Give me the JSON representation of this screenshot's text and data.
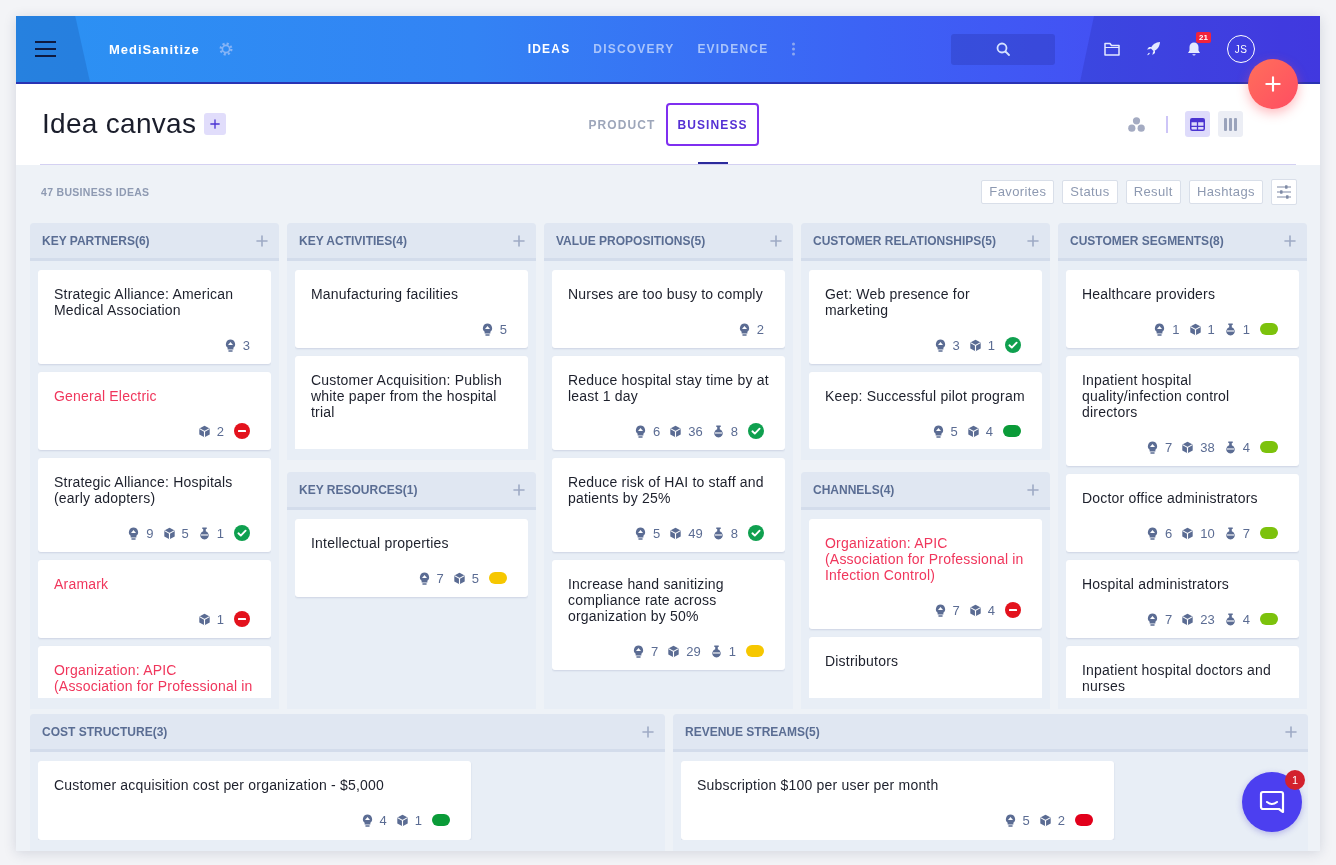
{
  "header": {
    "app_name": "MediSanitize",
    "nav": [
      {
        "label": "IDEAS",
        "selected": true
      },
      {
        "label": "DISCOVERY",
        "selected": false
      },
      {
        "label": "EVIDENCE",
        "selected": false
      }
    ],
    "notifications": "21",
    "avatar": "JS"
  },
  "page": {
    "title": "Idea canvas"
  },
  "tabs": [
    {
      "label": "PRODUCT",
      "selected": false
    },
    {
      "label": "BUSINESS",
      "selected": true
    }
  ],
  "view_modes": [
    {
      "kind": "grid",
      "selected": true
    },
    {
      "kind": "columns",
      "selected": false
    }
  ],
  "summary": "47 BUSINESS IDEAS",
  "filters": [
    "Favorites",
    "Status",
    "Result",
    "Hashtags"
  ],
  "canvas": {
    "columns": [
      {
        "sections": [
          {
            "title": "KEY PARTNERS(6)",
            "cards": [
              {
                "title": "Strategic Alliance: American Medical Association",
                "rejected": false,
                "metrics": [
                  {
                    "kind": "bulb",
                    "value": "3"
                  }
                ]
              },
              {
                "title": "General Electric",
                "rejected": true,
                "metrics": [
                  {
                    "kind": "cube",
                    "value": "2"
                  }
                ],
                "status": {
                  "kind": "minus"
                }
              },
              {
                "title": "Strategic Alliance: Hospitals (early adopters)",
                "rejected": false,
                "metrics": [
                  {
                    "kind": "bulb",
                    "value": "9"
                  },
                  {
                    "kind": "cube",
                    "value": "5"
                  },
                  {
                    "kind": "flask",
                    "value": "1"
                  }
                ],
                "status": {
                  "kind": "check"
                }
              },
              {
                "title": "Aramark",
                "rejected": true,
                "metrics": [
                  {
                    "kind": "cube",
                    "value": "1"
                  }
                ],
                "status": {
                  "kind": "minus"
                }
              },
              {
                "title": "Organization: APIC (Association for Professional in",
                "rejected": true
              }
            ]
          }
        ]
      },
      {
        "sections": [
          {
            "title": "KEY ACTIVITIES(4)",
            "cards": [
              {
                "title": "Manufacturing facilities",
                "rejected": false,
                "metrics": [
                  {
                    "kind": "bulb",
                    "value": "5"
                  }
                ]
              },
              {
                "title": "Customer Acquisition: Publish white paper from the hospital trial",
                "rejected": false
              }
            ]
          },
          {
            "title": "KEY RESOURCES(1)",
            "cards": [
              {
                "title": "Intellectual properties",
                "rejected": false,
                "metrics": [
                  {
                    "kind": "bulb",
                    "value": "7"
                  },
                  {
                    "kind": "cube",
                    "value": "5"
                  }
                ],
                "status": {
                  "kind": "pill",
                  "color": "#f6c700"
                }
              }
            ]
          }
        ]
      },
      {
        "sections": [
          {
            "title": "VALUE PROPOSITIONS(5)",
            "cards": [
              {
                "title": "Nurses are too busy to comply",
                "rejected": false,
                "metrics": [
                  {
                    "kind": "bulb",
                    "value": "2"
                  }
                ]
              },
              {
                "title": "Reduce hospital stay time by at least 1 day",
                "rejected": false,
                "metrics": [
                  {
                    "kind": "bulb",
                    "value": "6"
                  },
                  {
                    "kind": "cube",
                    "value": "36"
                  },
                  {
                    "kind": "flask",
                    "value": "8"
                  }
                ],
                "status": {
                  "kind": "check"
                }
              },
              {
                "title": "Reduce risk of HAI to staff and patients by 25%",
                "rejected": false,
                "metrics": [
                  {
                    "kind": "bulb",
                    "value": "5"
                  },
                  {
                    "kind": "cube",
                    "value": "49"
                  },
                  {
                    "kind": "flask",
                    "value": "8"
                  }
                ],
                "status": {
                  "kind": "check"
                }
              },
              {
                "title": "Increase hand sanitizing compliance rate across organization by 50%",
                "rejected": false,
                "metrics": [
                  {
                    "kind": "bulb",
                    "value": "7"
                  },
                  {
                    "kind": "cube",
                    "value": "29"
                  },
                  {
                    "kind": "flask",
                    "value": "1"
                  }
                ],
                "status": {
                  "kind": "pill",
                  "color": "#f6c700"
                }
              }
            ]
          }
        ]
      },
      {
        "sections": [
          {
            "title": "CUSTOMER RELATIONSHIPS(5)",
            "cards": [
              {
                "title": "Get: Web presence for marketing",
                "rejected": false,
                "metrics": [
                  {
                    "kind": "bulb",
                    "value": "3"
                  },
                  {
                    "kind": "cube",
                    "value": "1"
                  }
                ],
                "status": {
                  "kind": "check"
                }
              },
              {
                "title": "Keep: Successful pilot program",
                "rejected": false,
                "metrics": [
                  {
                    "kind": "bulb",
                    "value": "5"
                  },
                  {
                    "kind": "cube",
                    "value": "4"
                  }
                ],
                "status": {
                  "kind": "pill",
                  "color": "#0a9b38"
                }
              }
            ]
          },
          {
            "title": "CHANNELS(4)",
            "cards": [
              {
                "title": "Organization: APIC (Association for Professional in Infection Control)",
                "rejected": true,
                "metrics": [
                  {
                    "kind": "bulb",
                    "value": "7"
                  },
                  {
                    "kind": "cube",
                    "value": "4"
                  }
                ],
                "status": {
                  "kind": "minus"
                }
              },
              {
                "title": "Distributors",
                "rejected": false
              }
            ]
          }
        ]
      },
      {
        "sections": [
          {
            "title": "CUSTOMER SEGMENTS(8)",
            "cards": [
              {
                "title": "Healthcare providers",
                "rejected": false,
                "metrics": [
                  {
                    "kind": "bulb",
                    "value": "1"
                  },
                  {
                    "kind": "cube",
                    "value": "1"
                  },
                  {
                    "kind": "flask",
                    "value": "1"
                  }
                ],
                "status": {
                  "kind": "pill",
                  "color": "#7cc20c"
                }
              },
              {
                "title": "Inpatient hospital quality/infection control directors",
                "rejected": false,
                "metrics": [
                  {
                    "kind": "bulb",
                    "value": "7"
                  },
                  {
                    "kind": "cube",
                    "value": "38"
                  },
                  {
                    "kind": "flask",
                    "value": "4"
                  }
                ],
                "status": {
                  "kind": "pill",
                  "color": "#7cc20c"
                }
              },
              {
                "title": "Doctor office administrators",
                "rejected": false,
                "metrics": [
                  {
                    "kind": "bulb",
                    "value": "6"
                  },
                  {
                    "kind": "cube",
                    "value": "10"
                  },
                  {
                    "kind": "flask",
                    "value": "7"
                  }
                ],
                "status": {
                  "kind": "pill",
                  "color": "#7cc20c"
                }
              },
              {
                "title": "Hospital administrators",
                "rejected": false,
                "metrics": [
                  {
                    "kind": "bulb",
                    "value": "7"
                  },
                  {
                    "kind": "cube",
                    "value": "23"
                  },
                  {
                    "kind": "flask",
                    "value": "4"
                  }
                ],
                "status": {
                  "kind": "pill",
                  "color": "#7cc20c"
                }
              },
              {
                "title": "Inpatient hospital doctors and nurses",
                "rejected": false
              }
            ]
          }
        ]
      }
    ],
    "bottom_sections": [
      {
        "title": "COST STRUCTURE(3)",
        "cards": [
          {
            "title": "Customer acquisition cost per organization - $5,000",
            "rejected": false,
            "metrics": [
              {
                "kind": "bulb",
                "value": "4"
              },
              {
                "kind": "cube",
                "value": "1"
              }
            ],
            "status": {
              "kind": "pill",
              "color": "#0a9b38"
            }
          }
        ]
      },
      {
        "title": "REVENUE STREAMS(5)",
        "cards": [
          {
            "title": "Subscription $100 per user per month",
            "rejected": false,
            "metrics": [
              {
                "kind": "bulb",
                "value": "5"
              },
              {
                "kind": "cube",
                "value": "2"
              }
            ],
            "status": {
              "kind": "pill",
              "color": "#e2001b"
            }
          }
        ]
      }
    ]
  },
  "chat": {
    "unread": "1"
  }
}
